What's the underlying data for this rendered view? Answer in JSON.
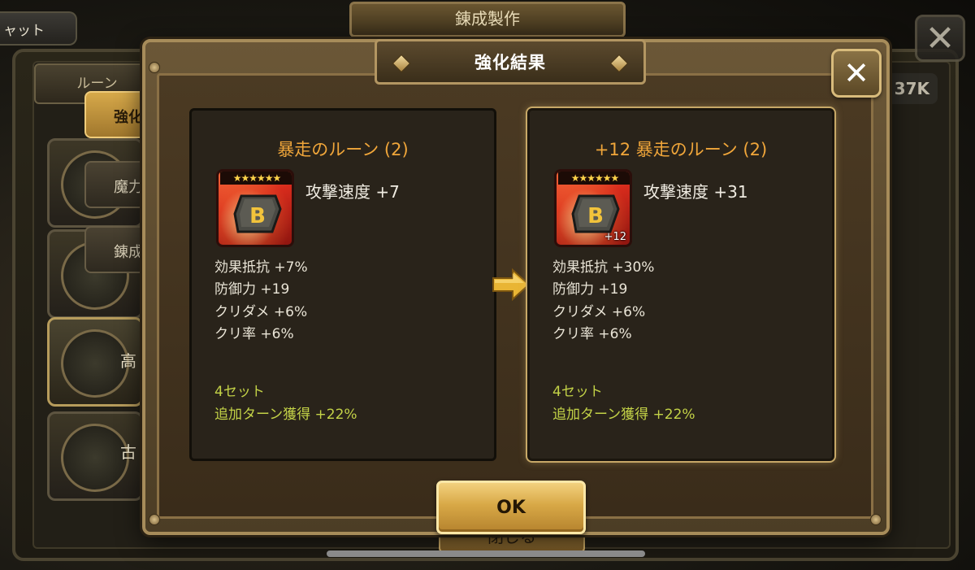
{
  "background": {
    "chat_tab": "ャット",
    "top_title": "錬成製作",
    "rune_header": "ルーン",
    "k_badge": "37K",
    "tabs": [
      "強化",
      "魔力変",
      "錬成"
    ],
    "side_labels": [
      "高",
      "古"
    ],
    "under_button": "閉じる"
  },
  "modal": {
    "title": "強化結果",
    "close_icon": "close-icon",
    "ok_label": "OK",
    "arrow_icon": "right-arrow-icon"
  },
  "before": {
    "rune_name": "暴走のルーン (2)",
    "stars": "★★★★★★",
    "level_badge": "",
    "main_stat": "攻撃速度 +7",
    "sub_stats": [
      "効果抵抗 +7%",
      "防御力 +19",
      "クリダメ +6%",
      "クリ率 +6%"
    ],
    "set_count": "4セット",
    "set_bonus": "追加ターン獲得 +22%"
  },
  "after": {
    "rune_name": "+12 暴走のルーン (2)",
    "stars": "★★★★★★",
    "level_badge": "+12",
    "main_stat": "攻撃速度 +31",
    "sub_stats": [
      "効果抵抗 +30%",
      "防御力 +19",
      "クリダメ +6%",
      "クリ率 +6%"
    ],
    "set_count": "4セット",
    "set_bonus": "追加ターン獲得 +22%"
  },
  "colors": {
    "rune_name": "#f0a63a",
    "set_text": "#c3d247",
    "ok_button": "#d8a846"
  }
}
